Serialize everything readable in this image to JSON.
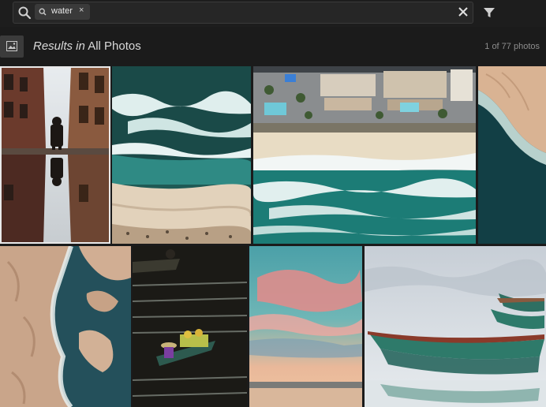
{
  "search": {
    "chip_text": "water",
    "chip_close": "×"
  },
  "results": {
    "prefix": "Results in",
    "scope": "All Photos",
    "count": "1 of 77 photos"
  },
  "icons": {
    "search": "search-icon",
    "chip": "search-icon",
    "clear": "close-icon",
    "filter": "filter-icon",
    "tile": "photo-icon"
  },
  "colors": {
    "background": "#1b1b1b",
    "search_field": "#262626",
    "chip": "#3a3a3a",
    "selection_border": "#e9e9e9"
  }
}
